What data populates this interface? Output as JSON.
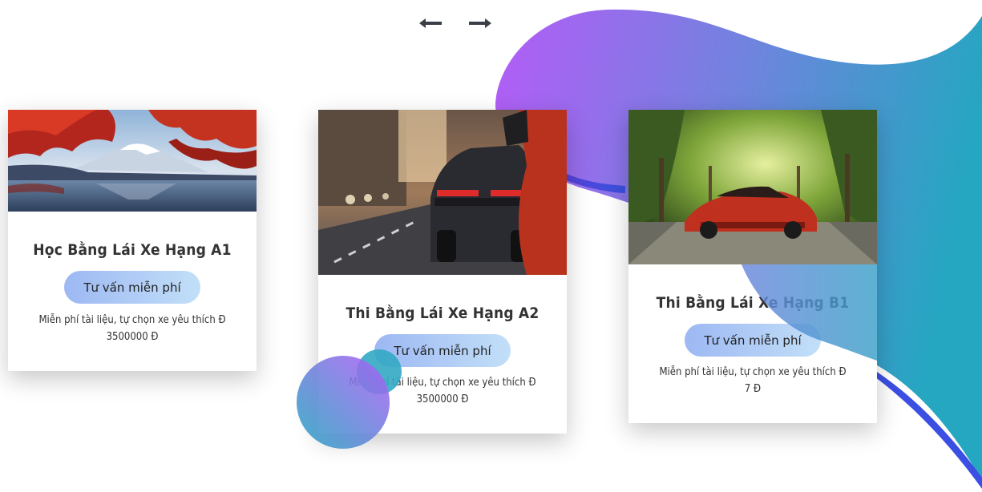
{
  "nav": {
    "prev_icon": "arrow-left-icon",
    "next_icon": "arrow-right-icon"
  },
  "colors": {
    "blob_start": "#b45cf7",
    "blob_end": "#25a6c1",
    "button_start": "#9db8f3",
    "button_end": "#c2dff8"
  },
  "cards": [
    {
      "title": "Học Bằng Lái Xe Hạng A1",
      "button": "Tư vấn miễn phí",
      "desc": "Miễn phí tài liệu, tự chọn xe yêu thích Đ",
      "price": "3500000 Đ"
    },
    {
      "title": "Thi Bằng Lái Xe Hạng A2",
      "button": "Tư vấn miễn phí",
      "desc": "Miễn phí tài liệu, tự chọn xe yêu thích Đ",
      "price": "3500000 Đ"
    },
    {
      "title": "Thi Bằng Lái Xe Hạng B1",
      "button": "Tư vấn miễn phí",
      "desc": "Miễn phí tài liệu, tự chọn xe yêu thích Đ",
      "price": "7 Đ"
    }
  ]
}
